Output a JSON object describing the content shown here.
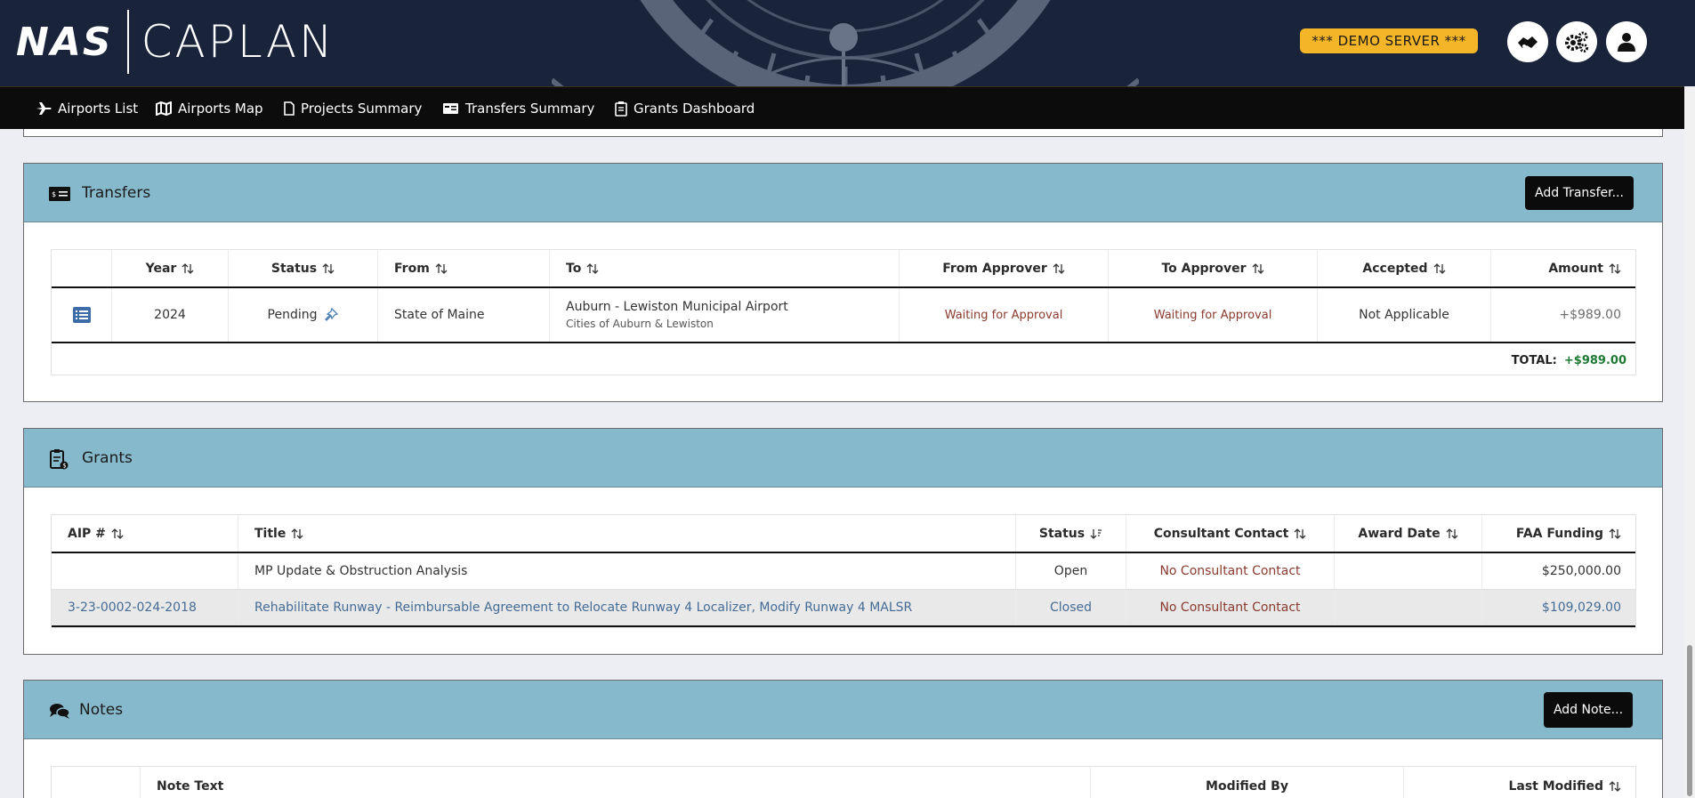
{
  "header": {
    "logo_left": "NAS",
    "logo_right": "CAPLAN",
    "demo_label": "*** DEMO SERVER ***"
  },
  "nav": {
    "items": [
      {
        "label": "Airports List",
        "icon": "airplane-icon"
      },
      {
        "label": "Airports Map",
        "icon": "map-icon"
      },
      {
        "label": "Projects Summary",
        "icon": "document-icon"
      },
      {
        "label": "Transfers Summary",
        "icon": "transfer-card-icon"
      },
      {
        "label": "Grants Dashboard",
        "icon": "clipboard-icon"
      }
    ]
  },
  "transfers": {
    "title": "Transfers",
    "add_button": "Add Transfer...",
    "columns": [
      "Year",
      "Status",
      "From",
      "To",
      "From Approver",
      "To Approver",
      "Accepted",
      "Amount"
    ],
    "rows": [
      {
        "year": "2024",
        "status": "Pending",
        "from": "State of Maine",
        "to": "Auburn - Lewiston Municipal Airport",
        "to_sub": "Cities of Auburn & Lewiston",
        "from_approver": "Waiting for Approval",
        "to_approver": "Waiting for Approval",
        "accepted": "Not Applicable",
        "amount": "+$989.00"
      }
    ],
    "total_label": "TOTAL:",
    "total_value": "+$989.00"
  },
  "grants": {
    "title": "Grants",
    "columns": [
      "AIP #",
      "Title",
      "Status",
      "Consultant Contact",
      "Award Date",
      "FAA Funding"
    ],
    "rows": [
      {
        "aip": "",
        "title": "MP Update & Obstruction Analysis",
        "status": "Open",
        "consultant": "No Consultant Contact",
        "award_date": "",
        "funding": "$250,000.00"
      },
      {
        "aip": "3-23-0002-024-2018",
        "title": "Rehabilitate Runway - Reimbursable Agreement to Relocate Runway 4 Localizer, Modify Runway 4 MALSR",
        "status": "Closed",
        "consultant": "No Consultant Contact",
        "award_date": "",
        "funding": "$109,029.00"
      }
    ]
  },
  "notes": {
    "title": "Notes",
    "add_button": "Add Note...",
    "columns": [
      "Note Text",
      "Modified By",
      "Last Modified"
    ]
  },
  "colors": {
    "header_bg": "#19243a",
    "panel_head": "#86b9cb",
    "demo_badge": "#f5b528",
    "approval_red": "#8a3a2e",
    "link_blue": "#456c96",
    "total_green": "#1f7a35"
  }
}
